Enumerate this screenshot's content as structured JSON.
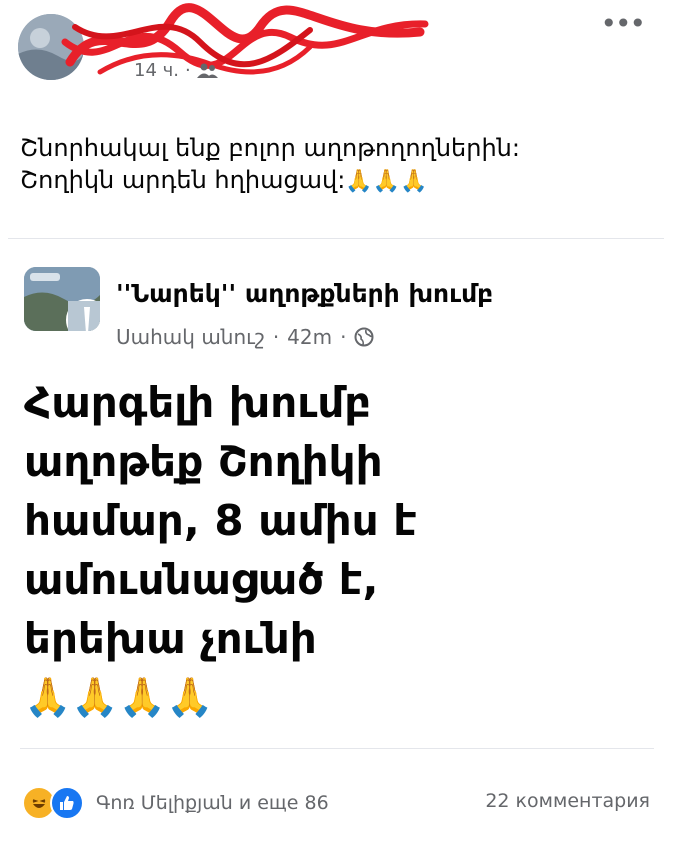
{
  "post": {
    "meta_time": "14 ч.",
    "meta_separator": "·",
    "text_line1": "Շնորհակալ ենք բոլոր աղոթողողներին:",
    "text_line2": "Շողիկն արդեն հղիացավ:",
    "text_emojis": "🙏🙏🙏",
    "more_label": "•••"
  },
  "shared": {
    "group_name": "''Նարեկ'' աղոթքների խումբ",
    "author": "Սահակ անուշ",
    "time": "42m",
    "dot": "·",
    "lines": [
      "Հարգելի խումբ",
      "աղոթեք Շողիկի",
      "համար, 8 ամիս է",
      "ամուսնացած է,",
      "երեխա չունի"
    ],
    "emojis": "🙏🙏🙏🙏"
  },
  "footer": {
    "reactions_text": "Գոռ Մելիքյան и еще 86",
    "comments_text": "22 комментария"
  },
  "icons": {
    "haha": "haha-reaction-icon",
    "like": "like-reaction-icon",
    "audience": "friends-icon",
    "globe": "globe-icon"
  },
  "colors": {
    "accent": "#1877f2",
    "scribble": "#e8202a",
    "muted": "#65676b"
  }
}
